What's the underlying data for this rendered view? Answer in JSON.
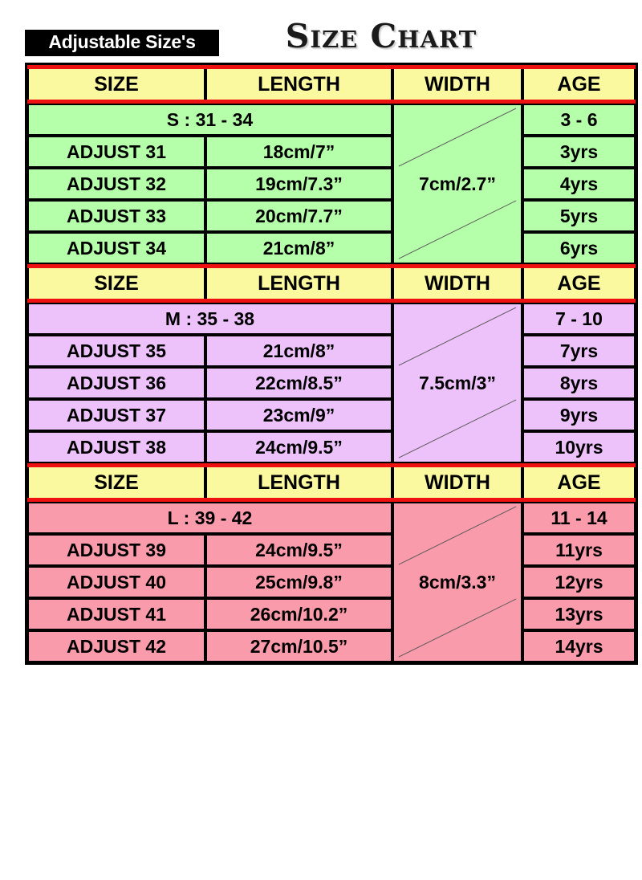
{
  "header": {
    "badge_label": "Adjustable Size's",
    "title": "Size Chart"
  },
  "colors": {
    "header_yellow": "#FBF9A0",
    "separator_red": "#EE1111",
    "section_s_green": "#B6FFAA",
    "section_m_purple": "#EDC2FB",
    "section_l_pink": "#F99BAA",
    "border_black": "#000000",
    "badge_background": "#000000",
    "badge_text": "#FFFFFF"
  },
  "columns": [
    "SIZE",
    "LENGTH",
    "WIDTH",
    "AGE"
  ],
  "sections": [
    {
      "id": "s",
      "headers": {
        "size": "SIZE",
        "length": "LENGTH",
        "width": "WIDTH",
        "age": "AGE"
      },
      "summary_label": "S : 31 - 34",
      "summary_age": "3 - 6",
      "width_value": "7cm/2.7”",
      "rows": [
        {
          "size": "ADJUST 31",
          "length": "18cm/7”",
          "age": "3yrs"
        },
        {
          "size": "ADJUST 32",
          "length": "19cm/7.3”",
          "age": "4yrs"
        },
        {
          "size": "ADJUST 33",
          "length": "20cm/7.7”",
          "age": "5yrs"
        },
        {
          "size": "ADJUST 34",
          "length": "21cm/8”",
          "age": "6yrs"
        }
      ]
    },
    {
      "id": "m",
      "headers": {
        "size": "SIZE",
        "length": "LENGTH",
        "width": "WIDTH",
        "age": "AGE"
      },
      "summary_label": "M : 35 - 38",
      "summary_age": "7 - 10",
      "width_value": "7.5cm/3”",
      "rows": [
        {
          "size": "ADJUST 35",
          "length": "21cm/8”",
          "age": "7yrs"
        },
        {
          "size": "ADJUST 36",
          "length": "22cm/8.5”",
          "age": "8yrs"
        },
        {
          "size": "ADJUST 37",
          "length": "23cm/9”",
          "age": "9yrs"
        },
        {
          "size": "ADJUST 38",
          "length": "24cm/9.5”",
          "age": "10yrs"
        }
      ]
    },
    {
      "id": "l",
      "headers": {
        "size": "SIZE",
        "length": "LENGTH",
        "width": "WIDTH",
        "age": "AGE"
      },
      "summary_label": "L : 39 - 42",
      "summary_age": "11 - 14",
      "width_value": "8cm/3.3”",
      "rows": [
        {
          "size": "ADJUST 39",
          "length": "24cm/9.5”",
          "age": "11yrs"
        },
        {
          "size": "ADJUST 40",
          "length": "25cm/9.8”",
          "age": "12yrs"
        },
        {
          "size": "ADJUST 41",
          "length": "26cm/10.2”",
          "age": "13yrs"
        },
        {
          "size": "ADJUST 42",
          "length": "27cm/10.5”",
          "age": "14yrs"
        }
      ]
    }
  ]
}
